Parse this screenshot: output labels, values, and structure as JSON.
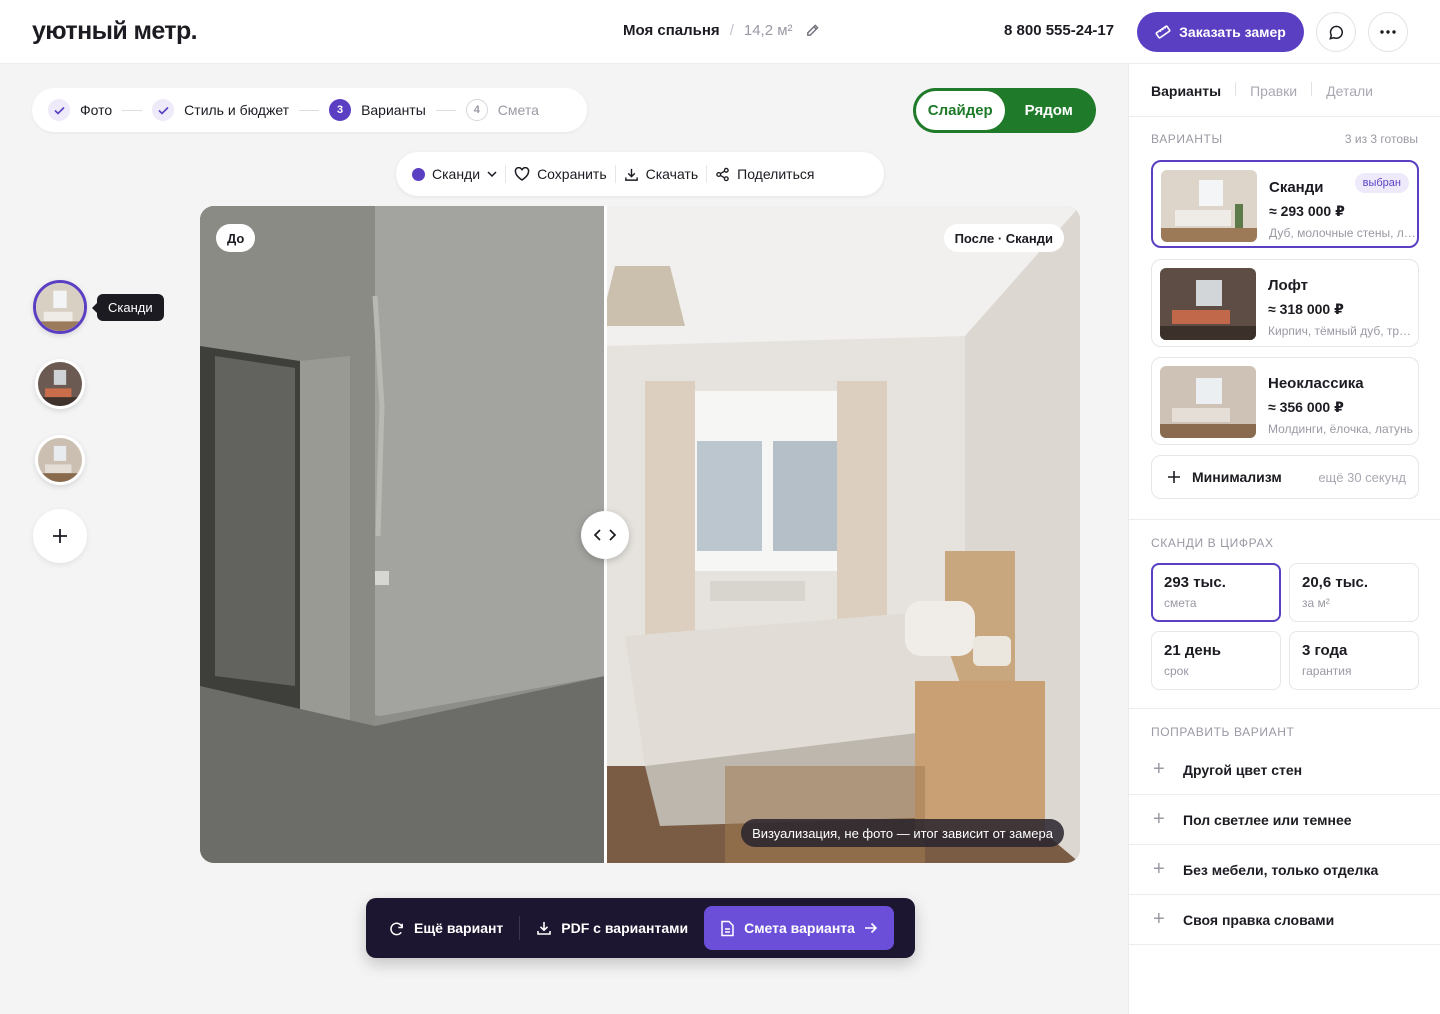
{
  "header": {
    "logo": "уютный метр.",
    "room": "Моя спальня",
    "crumb_sep": "/",
    "area": "14,2 м²",
    "phone": "8 800 555-24-17",
    "order_button": "Заказать замер"
  },
  "steps": [
    {
      "num": "",
      "label": "Фото",
      "state": "done"
    },
    {
      "num": "",
      "label": "Стиль и бюджет",
      "state": "done"
    },
    {
      "num": "3",
      "label": "Варианты",
      "state": "active"
    },
    {
      "num": "4",
      "label": "Смета",
      "state": "todo"
    }
  ],
  "mode": {
    "slider": "Слайдер",
    "side": "Рядом",
    "selected": "slider"
  },
  "toolbar": {
    "style": "Сканди",
    "style_color": "#5b3fc2",
    "save": "Сохранить",
    "download": "Скачать",
    "share": "Поделиться"
  },
  "thumbs": {
    "tooltip": "Сканди"
  },
  "stage": {
    "before": "До",
    "after": "После · Сканди",
    "disclaimer": "Визуализация, не фото — итог зависит от замера",
    "slider_position": 0.46
  },
  "actions": {
    "more": "Ещё вариант",
    "pdf": "PDF с вариантами",
    "estimate": "Смета варианта"
  },
  "panel": {
    "tabs": [
      "Варианты",
      "Правки",
      "Детали"
    ],
    "variants_title": "Варианты",
    "variants_status": "3 из 3 готовы",
    "variants": [
      {
        "name": "Сканди",
        "price": "≈ 293 000 ₽",
        "desc": "Дуб, молочные стены, лён",
        "badge": "выбран"
      },
      {
        "name": "Лофт",
        "price": "≈ 318 000 ₽",
        "desc": "Кирпич, тёмный дуб, трековый свет",
        "badge": ""
      },
      {
        "name": "Неоклассика",
        "price": "≈ 356 000 ₽",
        "desc": "Молдинги, ёлочка, латунь",
        "badge": ""
      }
    ],
    "pending": {
      "name": "Минимализм",
      "eta": "ещё 30 секунд"
    },
    "stats_title": "Сканди в цифрах",
    "stats": [
      {
        "value": "293 тыс.",
        "label": "смета"
      },
      {
        "value": "20,6 тыс.",
        "label": "за м²"
      },
      {
        "value": "21 день",
        "label": "срок"
      },
      {
        "value": "3 года",
        "label": "гарантия"
      }
    ],
    "fix_title": "Поправить вариант",
    "fixes": [
      "Другой цвет стен",
      "Пол светлее или темнее",
      "Без мебели, только отделка",
      "Своя правка словами"
    ]
  },
  "colors": {
    "accent": "#5b3fc2",
    "toggle": "#1f7a2a",
    "actionbar": "#1d1630"
  }
}
